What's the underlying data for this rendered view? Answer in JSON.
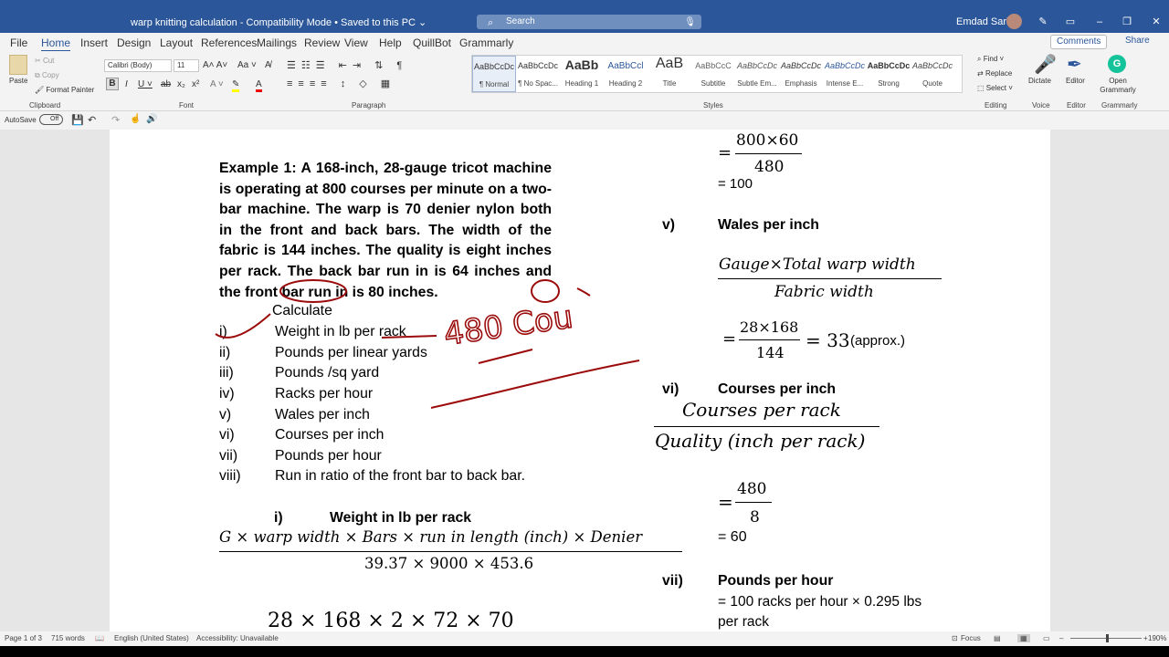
{
  "titlebar": {
    "doc_title": "warp knitting calculation  -  Compatibility Mode  •  Saved to this PC ⌄",
    "search_placeholder": "Search",
    "user_name": "Emdad Sarker"
  },
  "tabs": [
    "File",
    "Home",
    "Insert",
    "Design",
    "Layout",
    "References",
    "Mailings",
    "Review",
    "View",
    "Help",
    "QuillBot",
    "Grammarly"
  ],
  "tab_actions": {
    "comments": "Comments",
    "share": "Share"
  },
  "ribbon": {
    "clipboard": {
      "paste": "Paste",
      "cut": "Cut",
      "copy": "Copy",
      "format_painter": "Format Painter",
      "label": "Clipboard"
    },
    "font": {
      "name": "Calibri (Body)",
      "size": "11",
      "label": "Font"
    },
    "paragraph_label": "Paragraph",
    "styles": [
      {
        "sample": "AaBbCcDc",
        "name": "¶ Normal"
      },
      {
        "sample": "AaBbCcDc",
        "name": "¶ No Spac..."
      },
      {
        "sample": "AaBb",
        "name": "Heading 1"
      },
      {
        "sample": "AaBbCcl",
        "name": "Heading 2"
      },
      {
        "sample": "AaB",
        "name": "Title"
      },
      {
        "sample": "AaBbCcC",
        "name": "Subtitle"
      },
      {
        "sample": "AaBbCcDc",
        "name": "Subtle Em..."
      },
      {
        "sample": "AaBbCcDc",
        "name": "Emphasis"
      },
      {
        "sample": "AaBbCcDc",
        "name": "Intense E..."
      },
      {
        "sample": "AaBbCcDc",
        "name": "Strong"
      },
      {
        "sample": "AaBbCcDc",
        "name": "Quote"
      }
    ],
    "styles_label": "Styles",
    "editing": {
      "find": "Find",
      "replace": "Replace",
      "select": "Select",
      "label": "Editing"
    },
    "voice": {
      "dictate": "Dictate",
      "label": "Voice"
    },
    "editor": {
      "editor": "Editor",
      "label": "Editor"
    },
    "grammarly": {
      "open": "Open Grammarly",
      "label": "Grammarly"
    }
  },
  "qat": {
    "autosave": "AutoSave",
    "autosave_state": "Off"
  },
  "document": {
    "example_paragraph": "Example 1: A 168-inch, 28-gauge tricot machine is operating at 800 courses per minute on a two-bar machine. The warp is 70 denier nylon both in the front and back bars. The width of the fabric is 144 inches. The quality is eight inches per rack. The back bar run in is 64 inches and the front bar run in is 80 inches.",
    "calculate": "Calculate",
    "items": [
      {
        "num": "i)",
        "text": "Weight in lb per rack"
      },
      {
        "num": "ii)",
        "text": "Pounds per linear yards"
      },
      {
        "num": "iii)",
        "text": "Pounds /sq yard"
      },
      {
        "num": "iv)",
        "text": "Racks per hour"
      },
      {
        "num": "v)",
        "text": "Wales per inch"
      },
      {
        "num": "vi)",
        "text": "Courses per inch"
      },
      {
        "num": "vii)",
        "text": "Pounds per hour"
      },
      {
        "num": "viii)",
        "text": "Run in ratio of the front bar to back bar."
      }
    ],
    "sec_i": {
      "num": "i)",
      "title": "Weight in lb per rack"
    },
    "formula_i_num": "G × warp width  × Bars × run in length (inch)  × Denier",
    "formula_i_den": "39.37 × 9000 × 453.6",
    "formula_i_sub": "28 × 168 × 2 × 72 × 70",
    "right": {
      "frac_top_num": "800×60",
      "frac_top_den": "480",
      "eq_100": "= 100",
      "sec_v": {
        "num": "v)",
        "title": "Wales per inch"
      },
      "wales_num": "Gauge×Total warp width",
      "wales_den": "Fabric width",
      "wales_calc_num": "28×168",
      "wales_calc_den": "144",
      "wales_result": "= 33",
      "wales_approx": "(approx.)",
      "sec_vi": {
        "num": "vi)",
        "title": "Courses per inch"
      },
      "cpi_num": "Courses per rack",
      "cpi_den": "Quality (inch per rack)",
      "cpi_calc_num": "480",
      "cpi_calc_den": "8",
      "eq_60": "= 60",
      "sec_vii": {
        "num": "vii)",
        "title": "Pounds per hour"
      },
      "pph_line1": "= 100 racks per hour × 0.295 lbs",
      "pph_line2": "per rack"
    },
    "annotation": "480 Cou"
  },
  "statusbar": {
    "page": "Page 1 of 3",
    "words": "715 words",
    "language": "English (United States)",
    "accessibility": "Accessibility: Unavailable",
    "focus": "Focus",
    "zoom": "190%"
  }
}
